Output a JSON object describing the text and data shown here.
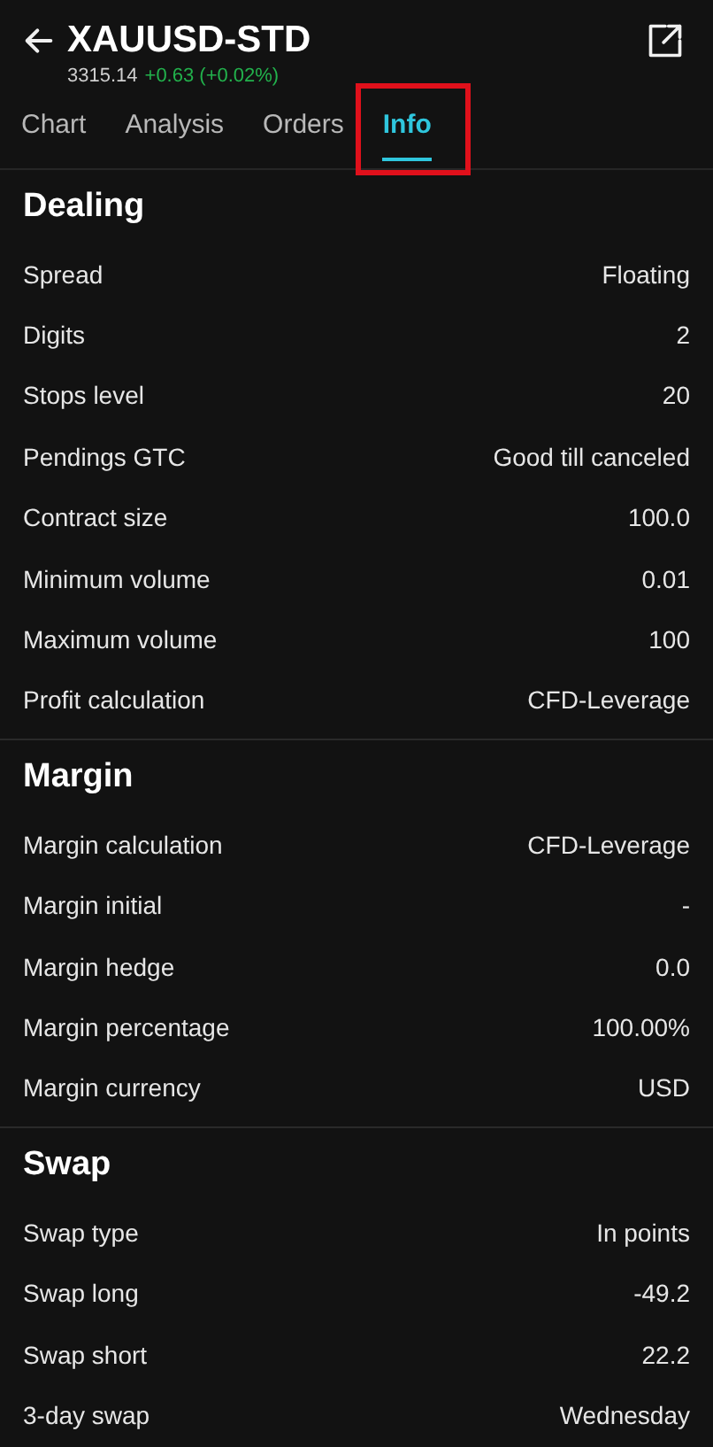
{
  "header": {
    "title": "XAUUSD-STD",
    "price": "3315.14",
    "change": "+0.63 (+0.02%)"
  },
  "tabs": [
    {
      "label": "Chart",
      "selected": false,
      "annotated": false
    },
    {
      "label": "Analysis",
      "selected": false,
      "annotated": false
    },
    {
      "label": "Orders",
      "selected": false,
      "annotated": false
    },
    {
      "label": "Info",
      "selected": true,
      "annotated": true
    }
  ],
  "sections": [
    {
      "title": "Dealing",
      "rows": [
        {
          "label": "Spread",
          "value": "Floating"
        },
        {
          "label": "Digits",
          "value": "2"
        },
        {
          "label": "Stops level",
          "value": "20"
        },
        {
          "label": "Pendings GTC",
          "value": "Good till canceled"
        },
        {
          "label": "Contract size",
          "value": "100.0"
        },
        {
          "label": "Minimum volume",
          "value": "0.01"
        },
        {
          "label": "Maximum volume",
          "value": "100"
        },
        {
          "label": "Profit calculation",
          "value": "CFD-Leverage"
        }
      ]
    },
    {
      "title": "Margin",
      "rows": [
        {
          "label": "Margin calculation",
          "value": "CFD-Leverage"
        },
        {
          "label": "Margin initial",
          "value": "-"
        },
        {
          "label": "Margin hedge",
          "value": "0.0"
        },
        {
          "label": "Margin percentage",
          "value": "100.00%"
        },
        {
          "label": "Margin currency",
          "value": "USD"
        }
      ]
    },
    {
      "title": "Swap",
      "rows": [
        {
          "label": "Swap type",
          "value": "In points"
        },
        {
          "label": "Swap long",
          "value": "-49.2"
        },
        {
          "label": "Swap short",
          "value": "22.2"
        },
        {
          "label": "3-day swap",
          "value": "Wednesday"
        }
      ]
    }
  ]
}
